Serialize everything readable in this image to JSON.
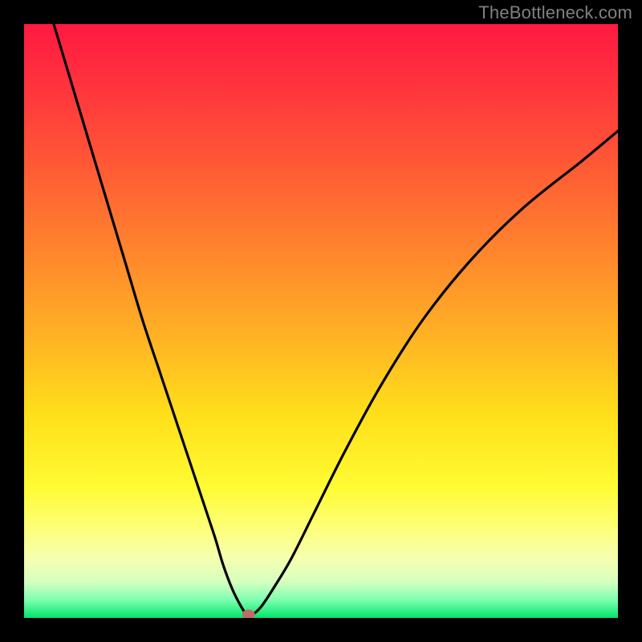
{
  "watermark": "TheBottleneck.com",
  "chart_data": {
    "type": "line",
    "title": "",
    "xlabel": "",
    "ylabel": "",
    "xlim": [
      0,
      100
    ],
    "ylim": [
      0,
      100
    ],
    "grid": false,
    "legend": false,
    "background": "rainbow-gradient-red-to-green-vertical",
    "series": [
      {
        "name": "bottleneck-curve",
        "color": "#000000",
        "x": [
          5,
          8,
          11,
          14,
          17,
          20,
          23,
          26,
          29,
          32,
          33.5,
          35,
          36.5,
          37.5,
          38.5,
          40,
          42,
          45,
          49,
          54,
          60,
          67,
          75,
          84,
          94,
          100
        ],
        "y": [
          100,
          90,
          80,
          70,
          60,
          50,
          41,
          32,
          23,
          14,
          9,
          5,
          2,
          0.6,
          0.6,
          2,
          5,
          10,
          18,
          28,
          39,
          50,
          60,
          69,
          77,
          82
        ]
      }
    ],
    "marker": {
      "x": 37.8,
      "y": 0.6,
      "color": "#c16a6a",
      "rx": 8,
      "ry": 6
    }
  }
}
